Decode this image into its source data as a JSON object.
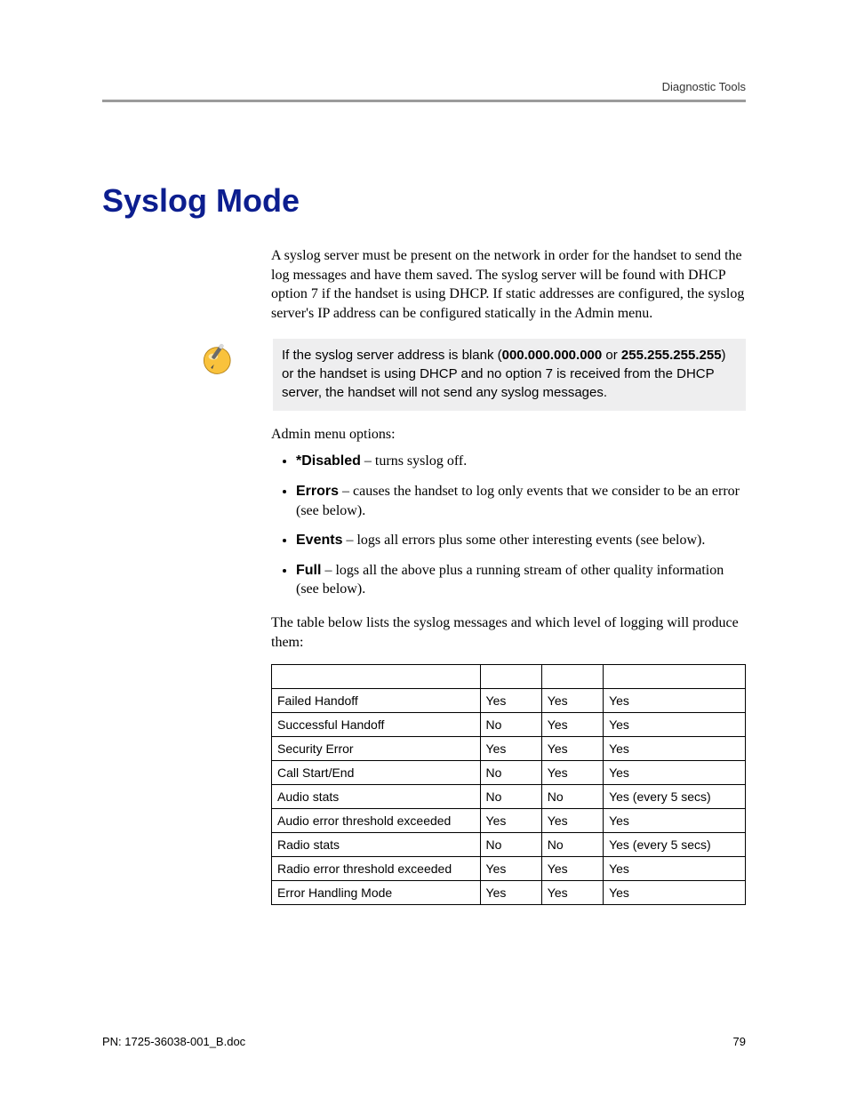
{
  "header": {
    "right": "Diagnostic Tools"
  },
  "title": "Syslog Mode",
  "intro": "A syslog server must be present on the network in order for the handset to send the log messages and have them saved. The syslog server will be found with DHCP option 7 if the handset is using DHCP. If static addresses are configured, the syslog server's IP address can be configured statically in the Admin menu.",
  "note": {
    "pre": "If the syslog server address is blank (",
    "bold1": "000.000.000.000",
    "mid": " or ",
    "bold2": "255.255.255.255",
    "post": ") or the handset is using DHCP and no option 7 is received from the DHCP server, the handset will not send any syslog messages."
  },
  "admin_label": "Admin menu options:",
  "options": [
    {
      "label": "*Disabled",
      "desc": " – turns syslog off."
    },
    {
      "label": "Errors",
      "desc": " – causes the handset to log only events that we consider to be an error (see below)."
    },
    {
      "label": "Events",
      "desc": " – logs all errors plus some other interesting events (see below)."
    },
    {
      "label": "Full",
      "desc": " – logs all the above plus a running stream of other quality information (see below)."
    }
  ],
  "table_intro": "The table below lists the syslog messages and which level of logging will produce them:",
  "table": {
    "headers": [
      "",
      "",
      "",
      ""
    ],
    "rows": [
      [
        "Failed Handoff",
        "Yes",
        "Yes",
        "Yes"
      ],
      [
        "Successful Handoff",
        "No",
        "Yes",
        "Yes"
      ],
      [
        "Security Error",
        "Yes",
        "Yes",
        "Yes"
      ],
      [
        "Call Start/End",
        "No",
        "Yes",
        "Yes"
      ],
      [
        "Audio stats",
        "No",
        "No",
        "Yes (every 5 secs)"
      ],
      [
        "Audio error threshold exceeded",
        "Yes",
        "Yes",
        "Yes"
      ],
      [
        "Radio stats",
        "No",
        "No",
        "Yes (every 5 secs)"
      ],
      [
        "Radio error threshold exceeded",
        "Yes",
        "Yes",
        "Yes"
      ],
      [
        "Error Handling Mode",
        "Yes",
        "Yes",
        "Yes"
      ]
    ]
  },
  "footer": {
    "left": "PN: 1725-36038-001_B.doc",
    "right": "79"
  }
}
